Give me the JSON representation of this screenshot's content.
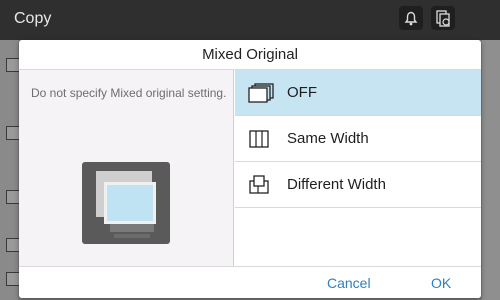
{
  "app": {
    "title": "Copy"
  },
  "topbar": {
    "icons": [
      "bell-icon",
      "copy-status-icon"
    ]
  },
  "dialog": {
    "title": "Mixed Original",
    "description": "Do not specify Mixed original setting.",
    "options": [
      {
        "label": "OFF",
        "icon": "stacked-pages-icon",
        "selected": true
      },
      {
        "label": "Same Width",
        "icon": "same-width-pages-icon",
        "selected": false
      },
      {
        "label": "Different Width",
        "icon": "different-width-pages-icon",
        "selected": false
      }
    ],
    "buttons": {
      "cancel": "Cancel",
      "ok": "OK"
    }
  },
  "colors": {
    "selected_row": "#c6e4f1",
    "button_text": "#2f7fbf",
    "topbar": "#2f2f2f"
  }
}
